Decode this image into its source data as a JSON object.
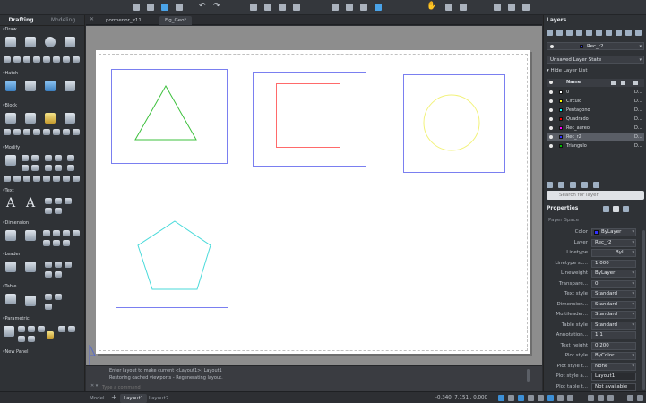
{
  "toolbar": {
    "icons": [
      "new-icon",
      "open-icon",
      "save-icon",
      "saveas-icon",
      "undo-icon",
      "redo-icon",
      "plot-icon",
      "print-icon",
      "publish-icon",
      "copy-icon",
      "cut-icon",
      "paste-icon",
      "match-icon",
      "pan-icon",
      "zoom-icon",
      "zoom-window-icon",
      "properties-icon",
      "layer-icon",
      "print-preview-icon"
    ]
  },
  "left": {
    "workspace_tabs": [
      "Drafting",
      "Modeling"
    ],
    "sections": [
      "Draw",
      "Hatch",
      "Block",
      "Modify",
      "Text",
      "Dimension",
      "Leader",
      "Table",
      "Parametric",
      "New Panel"
    ]
  },
  "doc_tabs": [
    "pormenor_v11",
    "Fig_Geo*"
  ],
  "command": {
    "lines": [
      "Enter layout to make current <Layout1>: Layout1",
      "Restoring cached viewports - Regenerating layout."
    ],
    "placeholder": "Type a command"
  },
  "status": {
    "tabs": [
      "Model",
      "Layout1",
      "Layout2"
    ],
    "coords": "-0.340, 7.151 , 0.000"
  },
  "layers": {
    "title": "Layers",
    "current_layer": "Rec_r2",
    "layer_state": "Unsaved Layer State",
    "hide_list": "Hide Layer List",
    "column_name": "Name",
    "rows": [
      {
        "name": "0",
        "color": "#ffffff",
        "d": "D..."
      },
      {
        "name": "Circulo",
        "color": "#ffff00",
        "d": "D..."
      },
      {
        "name": "Pentagono",
        "color": "#00ffff",
        "d": "D..."
      },
      {
        "name": "Quadrado",
        "color": "#ff0000",
        "d": "D..."
      },
      {
        "name": "Rec_aureo",
        "color": "#ff00ff",
        "d": "D..."
      },
      {
        "name": "Rec_r2",
        "color": "#3030ff",
        "d": "D..."
      },
      {
        "name": "Triangulo",
        "color": "#00c000",
        "d": "D..."
      }
    ],
    "selected": "Rec_r2",
    "search_placeholder": "Search for layer"
  },
  "properties": {
    "title": "Properties",
    "space": "Paper Space",
    "rows": [
      {
        "label": "Color",
        "value": "ByLayer"
      },
      {
        "label": "Layer",
        "value": "Rec_r2"
      },
      {
        "label": "Linetype",
        "value": "ByL..."
      },
      {
        "label": "Linetype sc...",
        "value": "1.000"
      },
      {
        "label": "Lineweight",
        "value": "ByLayer"
      },
      {
        "label": "Transpare...",
        "value": "0"
      },
      {
        "label": "Text style",
        "value": "Standard"
      },
      {
        "label": "Dimension...",
        "value": "Standard"
      },
      {
        "label": "Multileader...",
        "value": "Standard"
      },
      {
        "label": "Table style",
        "value": "Standard"
      },
      {
        "label": "Annotation...",
        "value": "1:1"
      },
      {
        "label": "Text height",
        "value": "0.200"
      },
      {
        "label": "Plot style",
        "value": "ByColor"
      },
      {
        "label": "Plot style t...",
        "value": "None"
      },
      {
        "label": "Plot style a...",
        "value": "Layout1"
      },
      {
        "label": "Plot table t...",
        "value": "Not available"
      }
    ]
  }
}
